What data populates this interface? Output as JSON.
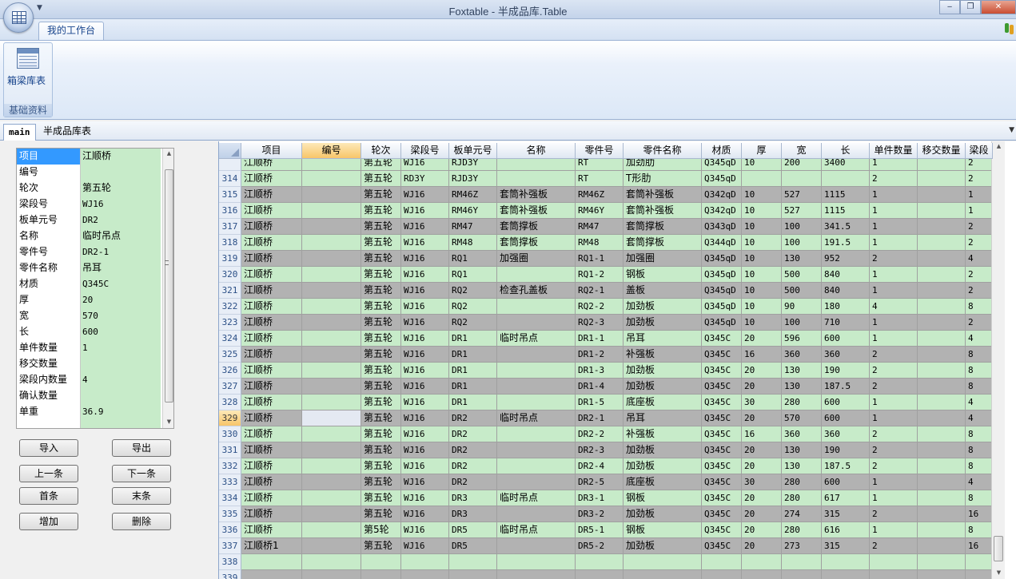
{
  "window": {
    "title": "Foxtable - 半成品库.Table",
    "minimize_glyph": "‒",
    "restore_glyph": "❐",
    "close_glyph": "✕"
  },
  "ribbon": {
    "tab_label": "我的工作台",
    "button_label": "箱梁库表",
    "button_icon": "table-icon",
    "group_label": "基础资料"
  },
  "doc_tabs": {
    "active": "main",
    "inactive": "半成品库表"
  },
  "record_fields": [
    {
      "label": "项目",
      "value": "江顺桥"
    },
    {
      "label": "编号",
      "value": ""
    },
    {
      "label": "轮次",
      "value": "第五轮"
    },
    {
      "label": "梁段号",
      "value": "WJ16"
    },
    {
      "label": "板单元号",
      "value": "DR2"
    },
    {
      "label": "名称",
      "value": "临时吊点"
    },
    {
      "label": "零件号",
      "value": "DR2-1"
    },
    {
      "label": "零件名称",
      "value": "吊耳"
    },
    {
      "label": "材质",
      "value": "Q345C"
    },
    {
      "label": "厚",
      "value": "20"
    },
    {
      "label": "宽",
      "value": "570"
    },
    {
      "label": "长",
      "value": "600"
    },
    {
      "label": "单件数量",
      "value": "1"
    },
    {
      "label": "移交数量",
      "value": ""
    },
    {
      "label": "梁段内数量",
      "value": "4"
    },
    {
      "label": "确认数量",
      "value": ""
    },
    {
      "label": "单重",
      "value": "36.9"
    }
  ],
  "buttons": {
    "import": "导入",
    "export": "导出",
    "prev": "上一条",
    "next": "下一条",
    "first": "首条",
    "last": "末条",
    "add": "增加",
    "delete": "删除"
  },
  "grid": {
    "columns": [
      "项目",
      "编号",
      "轮次",
      "梁段号",
      "板单元号",
      "名称",
      "零件号",
      "零件名称",
      "材质",
      "厚",
      "宽",
      "长",
      "单件数量",
      "移交数量",
      "梁段"
    ],
    "rows": [
      {
        "n": "",
        "c": [
          "江顺桥",
          "",
          "第五轮",
          "WJ16",
          "RJD3Y",
          "",
          "RT",
          "加劲肋",
          "Q345qD",
          "10",
          "200",
          "3400",
          "1",
          "",
          "2"
        ],
        "s": "g"
      },
      {
        "n": "314",
        "c": [
          "江顺桥",
          "",
          "第五轮",
          "RD3Y",
          "RJD3Y",
          "",
          "RT",
          "T形肋",
          "Q345qD",
          "",
          "",
          "",
          "2",
          "",
          "2"
        ],
        "s": "g"
      },
      {
        "n": "315",
        "c": [
          "江顺桥",
          "",
          "第五轮",
          "WJ16",
          "RM46Z",
          "套筒补强板",
          "RM46Z",
          "套筒补强板",
          "Q342qD",
          "10",
          "527",
          "1115",
          "1",
          "",
          "1"
        ],
        "s": "w"
      },
      {
        "n": "316",
        "c": [
          "江顺桥",
          "",
          "第五轮",
          "WJ16",
          "RM46Y",
          "套筒补强板",
          "RM46Y",
          "套筒补强板",
          "Q342qD",
          "10",
          "527",
          "1115",
          "1",
          "",
          "1"
        ],
        "s": "g"
      },
      {
        "n": "317",
        "c": [
          "江顺桥",
          "",
          "第五轮",
          "WJ16",
          "RM47",
          "套筒撑板",
          "RM47",
          "套筒撑板",
          "Q343qD",
          "10",
          "100",
          "341.5",
          "1",
          "",
          "2"
        ],
        "s": "w"
      },
      {
        "n": "318",
        "c": [
          "江顺桥",
          "",
          "第五轮",
          "WJ16",
          "RM48",
          "套筒撑板",
          "RM48",
          "套筒撑板",
          "Q344qD",
          "10",
          "100",
          "191.5",
          "1",
          "",
          "2"
        ],
        "s": "g"
      },
      {
        "n": "319",
        "c": [
          "江顺桥",
          "",
          "第五轮",
          "WJ16",
          "RQ1",
          "加强圈",
          "RQ1-1",
          "加强圈",
          "Q345qD",
          "10",
          "130",
          "952",
          "2",
          "",
          "4"
        ],
        "s": "w"
      },
      {
        "n": "320",
        "c": [
          "江顺桥",
          "",
          "第五轮",
          "WJ16",
          "RQ1",
          "",
          "RQ1-2",
          "钢板",
          "Q345qD",
          "10",
          "500",
          "840",
          "1",
          "",
          "2"
        ],
        "s": "g"
      },
      {
        "n": "321",
        "c": [
          "江顺桥",
          "",
          "第五轮",
          "WJ16",
          "RQ2",
          "检查孔盖板",
          "RQ2-1",
          "盖板",
          "Q345qD",
          "10",
          "500",
          "840",
          "1",
          "",
          "2"
        ],
        "s": "w"
      },
      {
        "n": "322",
        "c": [
          "江顺桥",
          "",
          "第五轮",
          "WJ16",
          "RQ2",
          "",
          "RQ2-2",
          "加劲板",
          "Q345qD",
          "10",
          "90",
          "180",
          "4",
          "",
          "8"
        ],
        "s": "g"
      },
      {
        "n": "323",
        "c": [
          "江顺桥",
          "",
          "第五轮",
          "WJ16",
          "RQ2",
          "",
          "RQ2-3",
          "加劲板",
          "Q345qD",
          "10",
          "100",
          "710",
          "1",
          "",
          "2"
        ],
        "s": "w"
      },
      {
        "n": "324",
        "c": [
          "江顺桥",
          "",
          "第五轮",
          "WJ16",
          "DR1",
          "临时吊点",
          "DR1-1",
          "吊耳",
          "Q345C",
          "20",
          "596",
          "600",
          "1",
          "",
          "4"
        ],
        "s": "g"
      },
      {
        "n": "325",
        "c": [
          "江顺桥",
          "",
          "第五轮",
          "WJ16",
          "DR1",
          "",
          "DR1-2",
          "补强板",
          "Q345C",
          "16",
          "360",
          "360",
          "2",
          "",
          "8"
        ],
        "s": "w"
      },
      {
        "n": "326",
        "c": [
          "江顺桥",
          "",
          "第五轮",
          "WJ16",
          "DR1",
          "",
          "DR1-3",
          "加劲板",
          "Q345C",
          "20",
          "130",
          "190",
          "2",
          "",
          "8"
        ],
        "s": "g"
      },
      {
        "n": "327",
        "c": [
          "江顺桥",
          "",
          "第五轮",
          "WJ16",
          "DR1",
          "",
          "DR1-4",
          "加劲板",
          "Q345C",
          "20",
          "130",
          "187.5",
          "2",
          "",
          "8"
        ],
        "s": "w"
      },
      {
        "n": "328",
        "c": [
          "江顺桥",
          "",
          "第五轮",
          "WJ16",
          "DR1",
          "",
          "DR1-5",
          "底座板",
          "Q345C",
          "30",
          "280",
          "600",
          "1",
          "",
          "4"
        ],
        "s": "g"
      },
      {
        "n": "329",
        "c": [
          "江顺桥",
          "",
          "第五轮",
          "WJ16",
          "DR2",
          "临时吊点",
          "DR2-1",
          "吊耳",
          "Q345C",
          "20",
          "570",
          "600",
          "1",
          "",
          "4"
        ],
        "s": "w",
        "cur": true
      },
      {
        "n": "330",
        "c": [
          "江顺桥",
          "",
          "第五轮",
          "WJ16",
          "DR2",
          "",
          "DR2-2",
          "补强板",
          "Q345C",
          "16",
          "360",
          "360",
          "2",
          "",
          "8"
        ],
        "s": "g"
      },
      {
        "n": "331",
        "c": [
          "江顺桥",
          "",
          "第五轮",
          "WJ16",
          "DR2",
          "",
          "DR2-3",
          "加劲板",
          "Q345C",
          "20",
          "130",
          "190",
          "2",
          "",
          "8"
        ],
        "s": "w"
      },
      {
        "n": "332",
        "c": [
          "江顺桥",
          "",
          "第五轮",
          "WJ16",
          "DR2",
          "",
          "DR2-4",
          "加劲板",
          "Q345C",
          "20",
          "130",
          "187.5",
          "2",
          "",
          "8"
        ],
        "s": "g"
      },
      {
        "n": "333",
        "c": [
          "江顺桥",
          "",
          "第五轮",
          "WJ16",
          "DR2",
          "",
          "DR2-5",
          "底座板",
          "Q345C",
          "30",
          "280",
          "600",
          "1",
          "",
          "4"
        ],
        "s": "w"
      },
      {
        "n": "334",
        "c": [
          "江顺桥",
          "",
          "第五轮",
          "WJ16",
          "DR3",
          "临时吊点",
          "DR3-1",
          "钢板",
          "Q345C",
          "20",
          "280",
          "617",
          "1",
          "",
          "8"
        ],
        "s": "g"
      },
      {
        "n": "335",
        "c": [
          "江顺桥",
          "",
          "第五轮",
          "WJ16",
          "DR3",
          "",
          "DR3-2",
          "加劲板",
          "Q345C",
          "20",
          "274",
          "315",
          "2",
          "",
          "16"
        ],
        "s": "w"
      },
      {
        "n": "336",
        "c": [
          "江顺桥",
          "",
          "第5轮",
          "WJ16",
          "DR5",
          "临时吊点",
          "DR5-1",
          "钢板",
          "Q345C",
          "20",
          "280",
          "616",
          "1",
          "",
          "8"
        ],
        "s": "g"
      },
      {
        "n": "337",
        "c": [
          "江顺桥1",
          "",
          "第五轮",
          "WJ16",
          "DR5",
          "",
          "DR5-2",
          "加劲板",
          "Q345C",
          "20",
          "273",
          "315",
          "2",
          "",
          "16"
        ],
        "s": "w"
      },
      {
        "n": "338",
        "c": [
          "",
          "",
          "",
          "",
          "",
          "",
          "",
          "",
          "",
          "",
          "",
          "",
          "",
          "",
          ""
        ],
        "s": "g"
      },
      {
        "n": "339",
        "c": [
          "",
          "",
          "",
          "",
          "",
          "",
          "",
          "",
          "",
          "",
          "",
          "",
          "",
          "",
          ""
        ],
        "s": "w"
      }
    ]
  }
}
